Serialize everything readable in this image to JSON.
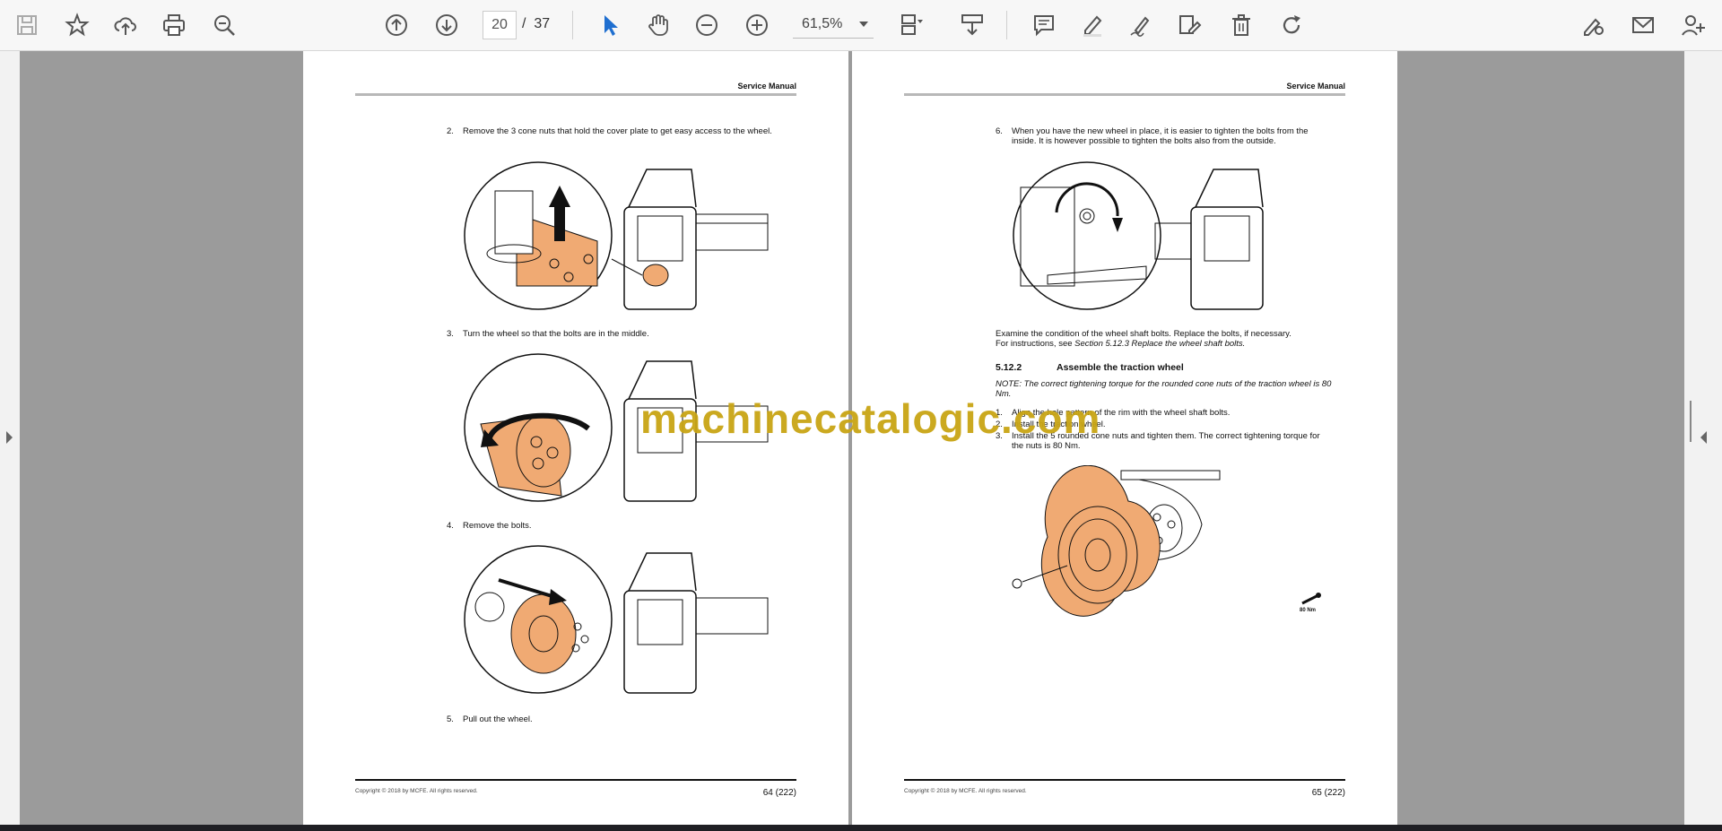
{
  "toolbar": {
    "icons": [
      "save-icon",
      "bookmark-star-icon",
      "upload-cloud-icon",
      "print-icon",
      "find-zoom-icon",
      "previous-page-icon",
      "next-page-icon",
      "select-cursor-icon",
      "hand-tool-icon",
      "zoom-out-icon",
      "zoom-in-icon",
      "page-view-icon",
      "scroll-mode-icon",
      "comment-icon",
      "highlight-pen-icon",
      "sign-icon",
      "edit-text-icon",
      "delete-icon",
      "rotate-icon",
      "fill-sign-icon",
      "email-icon",
      "share-user-icon"
    ],
    "current_page": "20",
    "page_separator": "/",
    "total_pages": "37",
    "zoom": "61,5%"
  },
  "watermark": "machinecatalogic.com",
  "colors": {
    "accent_blue": "#1f6fd0",
    "part_orange": "#f0aa73",
    "watermark_gold": "#c9a515"
  },
  "left_page": {
    "header": "Service Manual",
    "steps": [
      {
        "num": "2.",
        "text": "Remove the 3 cone nuts that hold the cover plate to get easy access to the wheel."
      },
      {
        "num": "3.",
        "text": "Turn the wheel so that the bolts are in the middle."
      },
      {
        "num": "4.",
        "text": "Remove the bolts."
      },
      {
        "num": "5.",
        "text": "Pull out the wheel."
      }
    ],
    "copyright": "Copyright © 2018 by MCFE. All rights reserved.",
    "page_number": "64 (222)"
  },
  "right_page": {
    "header": "Service Manual",
    "step6": {
      "num": "6.",
      "text": "When you have the new wheel in place, it is easier to tighten the bolts from the inside. It is however possible to tighten the bolts also from the outside."
    },
    "examine_text": "Examine the condition of the wheel shaft bolts. Replace the bolts, if necessary.",
    "instructions_prefix": "For instructions, see ",
    "instructions_ref": "Section 5.12.3 Replace the wheel shaft bolts.",
    "section_number": "5.12.2",
    "section_title": "Assemble the traction wheel",
    "note": "NOTE: The correct tightening torque for the rounded cone nuts of the traction wheel is 80 Nm.",
    "steps": [
      {
        "num": "1.",
        "text": "Align the hole pattern of the rim with the wheel shaft bolts."
      },
      {
        "num": "2.",
        "text": "Install the traction wheel."
      },
      {
        "num": "3.",
        "text": "Install the 5 rounded cone nuts and tighten them. The correct tightening torque for the nuts is 80 Nm."
      }
    ],
    "torque_label": "80 Nm",
    "copyright": "Copyright © 2018 by MCFE. All rights reserved.",
    "page_number": "65 (222)"
  }
}
